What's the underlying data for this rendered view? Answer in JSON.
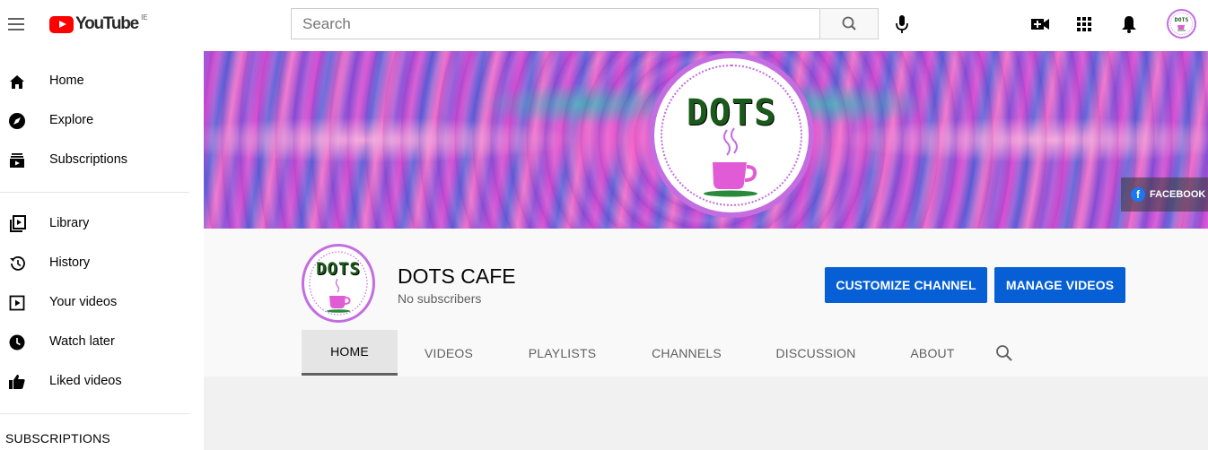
{
  "header": {
    "logo_text": "YouTube",
    "logo_country": "IE",
    "search_placeholder": "Search"
  },
  "sidebar": {
    "items": [
      {
        "label": "Home",
        "icon": "home-icon"
      },
      {
        "label": "Explore",
        "icon": "compass-icon"
      },
      {
        "label": "Subscriptions",
        "icon": "subscriptions-icon"
      },
      {
        "label": "Library",
        "icon": "library-icon"
      },
      {
        "label": "History",
        "icon": "history-icon"
      },
      {
        "label": "Your videos",
        "icon": "your-videos-icon"
      },
      {
        "label": "Watch later",
        "icon": "clock-icon"
      },
      {
        "label": "Liked videos",
        "icon": "thumbs-up-icon"
      }
    ],
    "subscriptions_heading": "SUBSCRIPTIONS"
  },
  "banner": {
    "badge_text": "DOTS",
    "facebook_label": "FACEBOOK"
  },
  "channel": {
    "avatar_text": "DOTS",
    "name": "DOTS CAFE",
    "subscribers": "No subscribers",
    "customize_label": "CUSTOMIZE CHANNEL",
    "manage_label": "MANAGE VIDEOS",
    "tabs": [
      {
        "label": "HOME",
        "active": true
      },
      {
        "label": "VIDEOS",
        "active": false
      },
      {
        "label": "PLAYLISTS",
        "active": false
      },
      {
        "label": "CHANNELS",
        "active": false
      },
      {
        "label": "DISCUSSION",
        "active": false
      },
      {
        "label": "ABOUT",
        "active": false
      }
    ]
  },
  "colors": {
    "brand_red": "#ff0000",
    "accent_blue": "#065fd4",
    "avatar_ring": "#c36de0",
    "cup_pink": "#e25bd6"
  }
}
